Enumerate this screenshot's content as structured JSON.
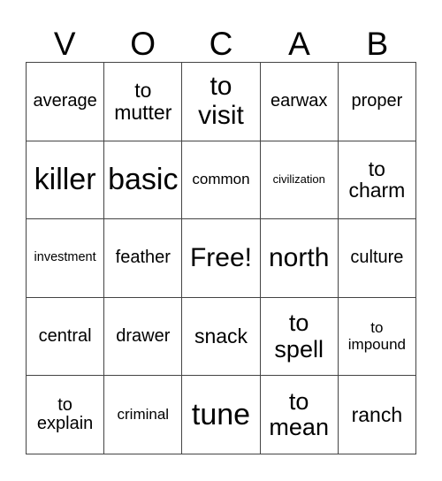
{
  "card": {
    "title_letters": [
      "V",
      "O",
      "C",
      "A",
      "B"
    ],
    "free_space_label": "Free!",
    "grid": [
      [
        {
          "text": "average",
          "size": "fs-m"
        },
        {
          "text": "to\nmutter",
          "size": "fs-ml"
        },
        {
          "text": "to\nvisit",
          "size": "fs-xl"
        },
        {
          "text": "earwax",
          "size": "fs-m"
        },
        {
          "text": "proper",
          "size": "fs-m"
        }
      ],
      [
        {
          "text": "killer",
          "size": "fs-xxl"
        },
        {
          "text": "basic",
          "size": "fs-xxl"
        },
        {
          "text": "common",
          "size": "fs-sm"
        },
        {
          "text": "civilization",
          "size": "fs-xs"
        },
        {
          "text": "to\ncharm",
          "size": "fs-ml"
        }
      ],
      [
        {
          "text": "investment",
          "size": "fs-s"
        },
        {
          "text": "feather",
          "size": "fs-m"
        },
        {
          "text": "Free!",
          "size": "fs-xl"
        },
        {
          "text": "north",
          "size": "fs-xl"
        },
        {
          "text": "culture",
          "size": "fs-m"
        }
      ],
      [
        {
          "text": "central",
          "size": "fs-m"
        },
        {
          "text": "drawer",
          "size": "fs-m"
        },
        {
          "text": "snack",
          "size": "fs-ml"
        },
        {
          "text": "to\nspell",
          "size": "fs-l"
        },
        {
          "text": "to\nimpound",
          "size": "fs-sm"
        }
      ],
      [
        {
          "text": "to\nexplain",
          "size": "fs-m"
        },
        {
          "text": "criminal",
          "size": "fs-sm"
        },
        {
          "text": "tune",
          "size": "fs-xxl"
        },
        {
          "text": "to\nmean",
          "size": "fs-l"
        },
        {
          "text": "ranch",
          "size": "fs-ml"
        }
      ]
    ],
    "colors": {
      "background": "#ffffff",
      "text": "#000000",
      "border": "#444444"
    }
  }
}
